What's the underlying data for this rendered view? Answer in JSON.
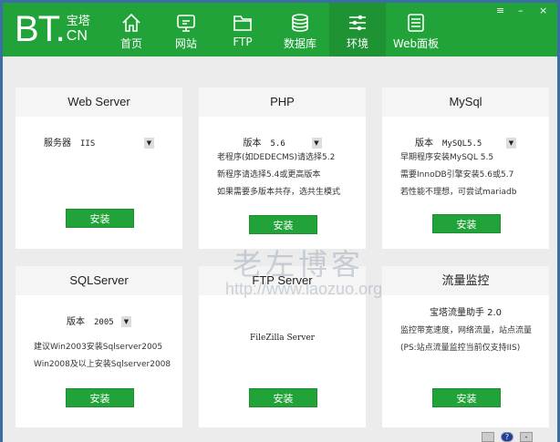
{
  "logo": {
    "main": "BT.",
    "cn_top": "宝塔",
    "cn_bottom": "CN"
  },
  "nav": [
    {
      "label": "首页",
      "icon": "home-icon"
    },
    {
      "label": "网站",
      "icon": "monitor-icon"
    },
    {
      "label": "FTP",
      "icon": "folder-icon"
    },
    {
      "label": "数据库",
      "icon": "database-icon"
    },
    {
      "label": "环境",
      "icon": "sliders-icon",
      "active": true
    },
    {
      "label": "Web面板",
      "icon": "list-icon"
    }
  ],
  "window_controls": {
    "menu": "≡",
    "minimize": "–",
    "close": "×"
  },
  "cards": {
    "web": {
      "title": "Web Server",
      "select_label": "服务器",
      "select_value": "IIS",
      "install": "安装"
    },
    "php": {
      "title": "PHP",
      "select_label": "版本",
      "select_value": "5.6",
      "lines": [
        "老程序(如DEDECMS)请选择5.2",
        "新程序请选择5.4或更高版本",
        "如果需要多版本共存，选共生模式"
      ],
      "install": "安装"
    },
    "mysql": {
      "title": "MySql",
      "select_label": "版本",
      "select_value": "MySQL5.5",
      "lines": [
        "早期程序安装MySQL 5.5",
        "需要InnoDB引擎安装5.6或5.7",
        "若性能不理想，可尝试mariadb"
      ],
      "install": "安装"
    },
    "sqlserver": {
      "title": "SQLServer",
      "select_label": "版本",
      "select_value": "2005",
      "lines": [
        "建议Win2003安装Sqlserver2005",
        "Win2008及以上安装Sqlserver2008"
      ],
      "install": "安装"
    },
    "ftp": {
      "title": "FTP Server",
      "name": "FileZilla Server",
      "install": "安装"
    },
    "traffic": {
      "title": "流量监控",
      "subtitle": "宝塔流量助手 2.0",
      "desc": "监控带宽速度，网络流量，站点流量(PS:站点流量监控当前仅支持IIS)",
      "install": "安装"
    }
  },
  "watermark": {
    "title": "老左博客",
    "url": "http://www.laozuo.org"
  },
  "colors": {
    "brand": "#22a33a",
    "frame": "#3a6ea5"
  }
}
